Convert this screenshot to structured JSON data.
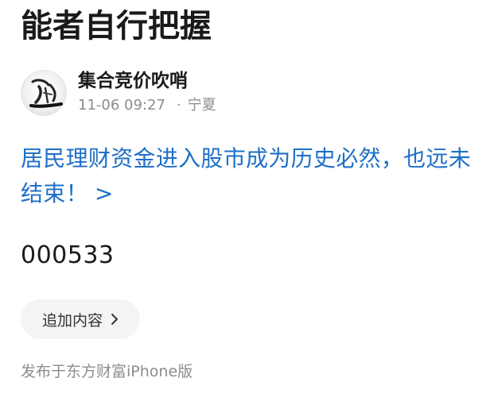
{
  "post": {
    "title": "能者自行把握",
    "author": {
      "name": "集合竞价吹哨",
      "avatar_icon": "calligraphy-avatar"
    },
    "meta": {
      "time": "11-06 09:27",
      "separator": "·",
      "location": "宁夏"
    },
    "headline_link": {
      "text": "居民理财资金进入股市成为历史必然，也远未结束！",
      "arrow": ">"
    },
    "stock_code": "000533",
    "add_content": {
      "label": "追加内容",
      "icon": "chevron-right-icon"
    },
    "source": "发布于东方财富iPhone版"
  },
  "colors": {
    "link": "#1e6fc8",
    "meta_gray": "#8c8c8c",
    "button_bg": "#f4f4f4"
  }
}
